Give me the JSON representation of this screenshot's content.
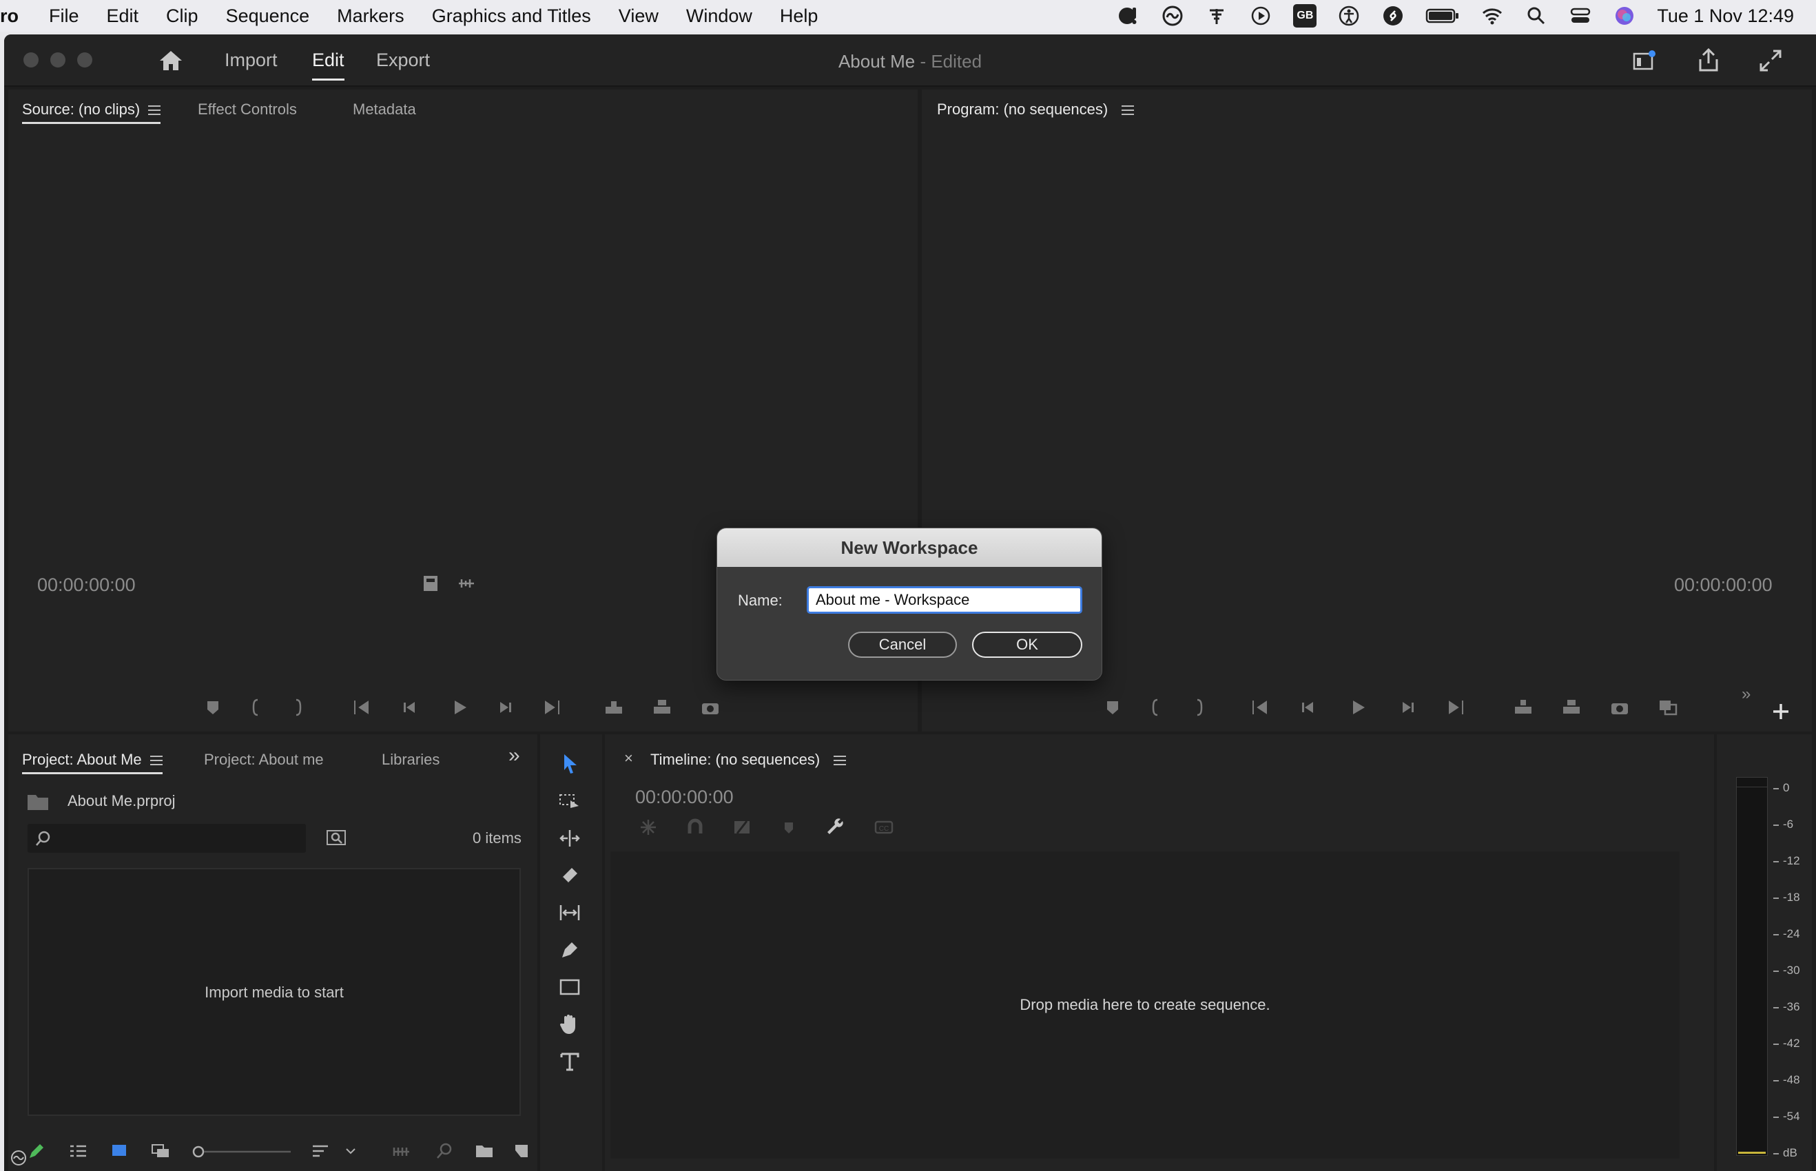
{
  "menubar": {
    "app_name": "ro",
    "items": [
      "File",
      "Edit",
      "Clip",
      "Sequence",
      "Markers",
      "Graphics and Titles",
      "View",
      "Window",
      "Help"
    ],
    "status_icons": [
      "notification-icon",
      "creative-cloud-icon",
      "antenna-icon",
      "play-circle-icon",
      "keyboard-layout-icon",
      "accessibility-icon",
      "shazam-icon",
      "battery-icon",
      "wifi-icon",
      "spotlight-icon",
      "control-center-icon",
      "siri-icon"
    ],
    "keyboard_layout": "GB",
    "clock": "Tue 1 Nov  12:49"
  },
  "titlebar": {
    "tabs": [
      "Import",
      "Edit",
      "Export"
    ],
    "active_tab": "Edit",
    "doc_title": "About Me",
    "doc_status": " - Edited"
  },
  "source_panel": {
    "tabs": [
      "Source: (no clips)",
      "Effect Controls",
      "Metadata"
    ],
    "timecode": "00:00:00:00"
  },
  "program_panel": {
    "tab": "Program: (no sequences)",
    "timecode": "00:00:00:00"
  },
  "project_panel": {
    "tabs": [
      "Project: About Me",
      "Project: About me",
      "Libraries"
    ],
    "file_name": "About Me.prproj",
    "search_placeholder": "",
    "items_count": "0 items",
    "empty_message": "Import media to start"
  },
  "timeline_panel": {
    "tab": "Timeline: (no sequences)",
    "timecode": "00:00:00:00",
    "empty_message": "Drop media here to create sequence."
  },
  "audio_meter": {
    "ticks": [
      "0",
      "-6",
      "-12",
      "-18",
      "-24",
      "-30",
      "-36",
      "-42",
      "-48",
      "-54",
      "dB"
    ]
  },
  "dialog": {
    "title": "New Workspace",
    "name_label": "Name:",
    "name_value": "About me - Workspace",
    "cancel_label": "Cancel",
    "ok_label": "OK"
  },
  "colors": {
    "accent": "#3e7ce0",
    "panel_bg": "#232323",
    "app_bg": "#1d1d1d"
  }
}
